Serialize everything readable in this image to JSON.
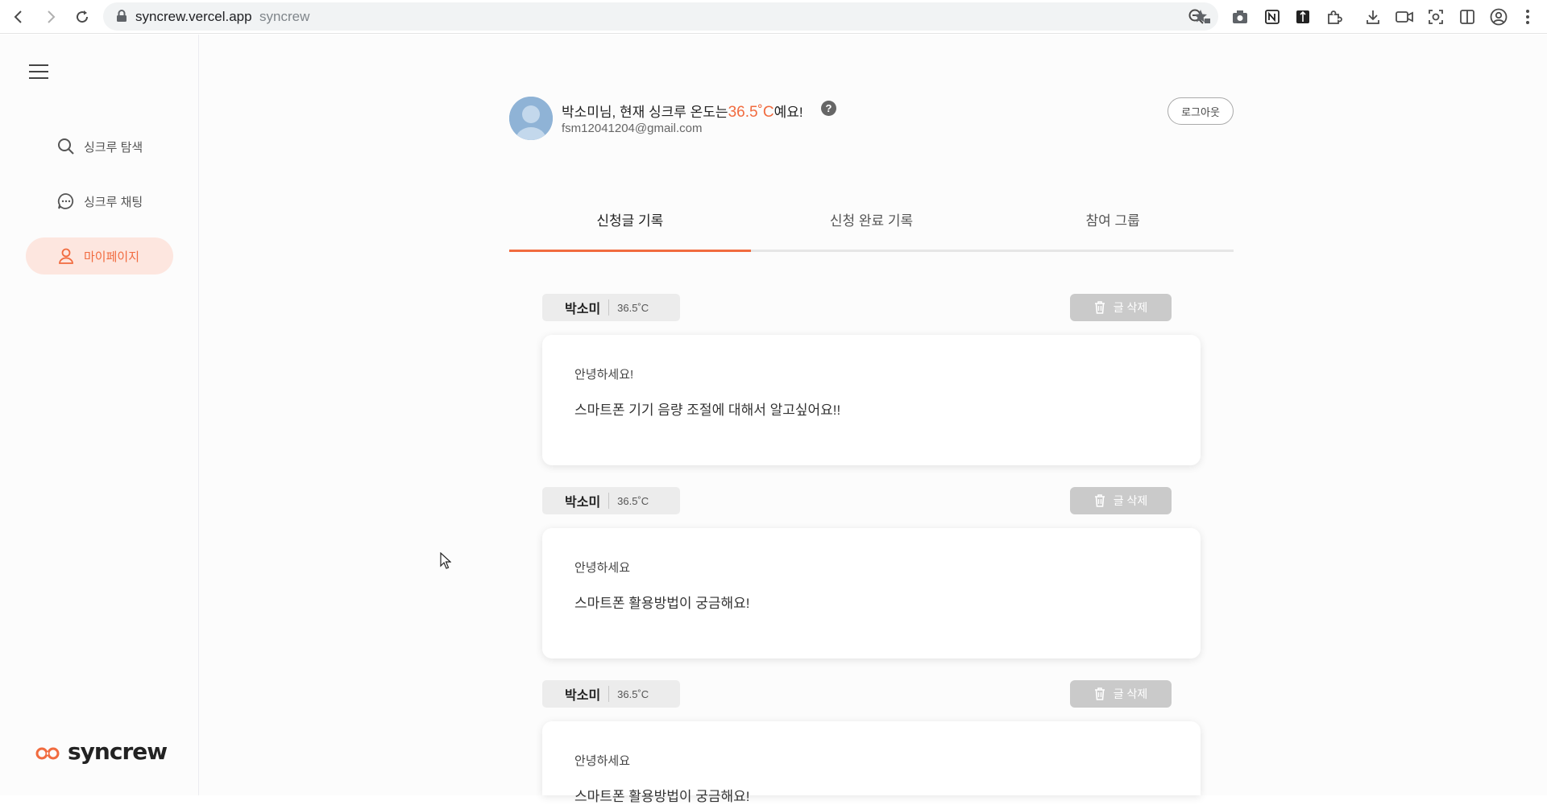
{
  "browser": {
    "url_domain": "syncrew.vercel.app",
    "page_title": "syncrew"
  },
  "sidebar": {
    "items": [
      {
        "label": "싱크루 탐색",
        "icon": "search-icon"
      },
      {
        "label": "싱크루 채팅",
        "icon": "chat-bubble-icon"
      },
      {
        "label": "마이페이지",
        "icon": "user-icon",
        "active": true
      }
    ],
    "logo_text": "syncrew"
  },
  "profile": {
    "greeting_prefix": "박소미님, 현재 싱크루 온도는",
    "temperature": "36.5˚C",
    "greeting_suffix": "예요!",
    "help": "?",
    "email": "fsm12041204@gmail.com",
    "logout_label": "로그아웃"
  },
  "tabs": [
    {
      "label": "신청글 기록",
      "active": true
    },
    {
      "label": "신청 완료 기록"
    },
    {
      "label": "참여 그룹"
    }
  ],
  "posts": [
    {
      "author": "박소미",
      "temperature": "36.5˚C",
      "delete_label": "글 삭제",
      "title": "안녕하세요!",
      "body": "스마트폰 기기 음량 조절에 대해서 알고싶어요!!"
    },
    {
      "author": "박소미",
      "temperature": "36.5˚C",
      "delete_label": "글 삭제",
      "title": "안녕하세요",
      "body": "스마트폰 활용방법이 궁금해요!"
    },
    {
      "author": "박소미",
      "temperature": "36.5˚C",
      "delete_label": "글 삭제",
      "title": "안녕하세요",
      "body": "스마트폰 활용방법이 궁금해요!"
    }
  ],
  "colors": {
    "accent": "#f16b3f",
    "active_menu_bg": "#fde6df",
    "delete_button": "#cacaca"
  }
}
